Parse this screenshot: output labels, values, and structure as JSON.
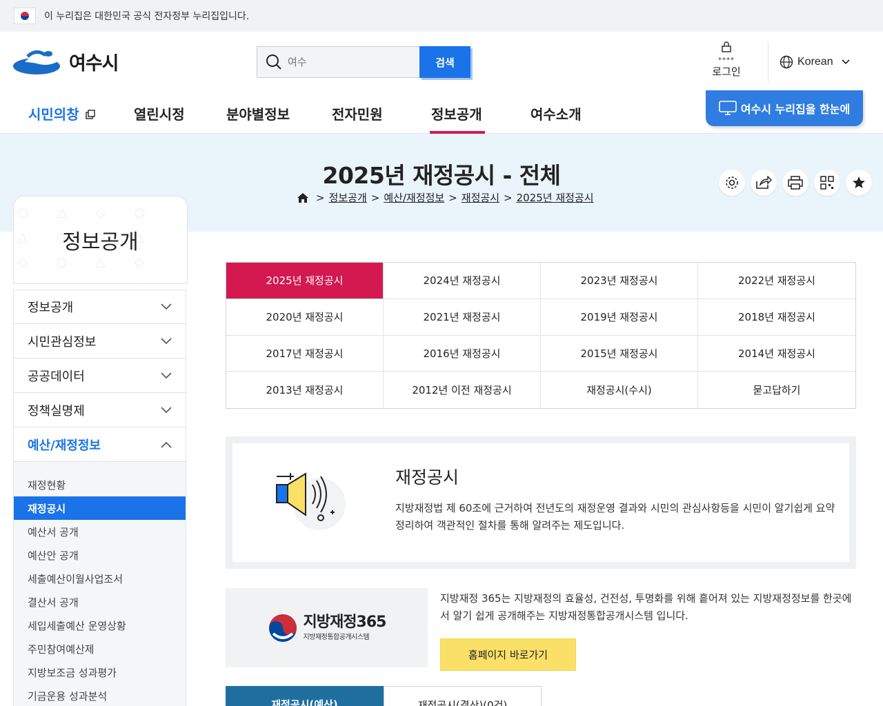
{
  "gov_banner": {
    "text": "이 누리집은 대한민국 공식 전자정부 누리집입니다."
  },
  "header": {
    "logo_text": "여수시",
    "search": {
      "placeholder": "여수",
      "button": "검색"
    },
    "login": {
      "stars": "****",
      "label": "로그인"
    },
    "language": "Korean"
  },
  "gnb": {
    "items": [
      "시민의창",
      "열린시정",
      "분야별정보",
      "전자민원",
      "정보공개",
      "여수소개"
    ],
    "active_index": 4,
    "quick_button": "여수시 누리집을 한눈에"
  },
  "page": {
    "title": "2025년 재정공시 - 전체",
    "breadcrumb": [
      "정보공개",
      "예산/재정정보",
      "재정공시",
      "2025년 재정공시"
    ],
    "breadcrumb_sep": ">"
  },
  "lnb": {
    "title": "정보공개",
    "items": [
      "정보공개",
      "시민관심정보",
      "공공데이터",
      "정책실명제",
      "예산/재정정보"
    ],
    "open_index": 4,
    "sub_items": [
      "재정현황",
      "재정공시",
      "예산서 공개",
      "예산안 공개",
      "세출예산이월사업조서",
      "결산서 공개",
      "세입세출예산 운영상황",
      "주민참여예산제",
      "지방보조금 성과평가",
      "기금운용 성과분석"
    ],
    "sub_active_index": 1
  },
  "year_tabs": [
    "2025년 재정공시",
    "2024년 재정공시",
    "2023년 재정공시",
    "2022년 재정공시",
    "2020년 재정공시",
    "2021년 재정공시",
    "2019년 재정공시",
    "2018년 재정공시",
    "2017년 재정공시",
    "2016년 재정공시",
    "2015년 재정공시",
    "2014년 재정공시",
    "2013년 재정공시",
    "2012년 이전 재정공시",
    "재정공시(수시)",
    "묻고답하기"
  ],
  "intro": {
    "title": "재정공시",
    "desc": "지방재정법 제 60조에 근거하여 전년도의 재정운영 결과와 시민의 관심사항등을 시민이 알기쉽게 요약정리하여 객관적인 절차를 통해 알려주는 제도입니다."
  },
  "lofin": {
    "name": "지방재정365",
    "sub": "지방재정통합공개시스템",
    "desc": "지방재정 365는 지방재정의 효율성, 건전성, 투명화를 위해 흩어져 있는 지방재정정보를 한곳에서 알기 쉽게 공개해주는 지방재정통합공개시스템 입니다.",
    "button": "홈페이지 바로가기"
  },
  "bottom_tabs": [
    "재정공시(예산)",
    "재정공시(결산)(0건)"
  ],
  "colors": {
    "primary": "#1a73e8",
    "accent": "#d3194f",
    "yellow": "#fbe067",
    "tab_dark": "#1e6fa0"
  }
}
